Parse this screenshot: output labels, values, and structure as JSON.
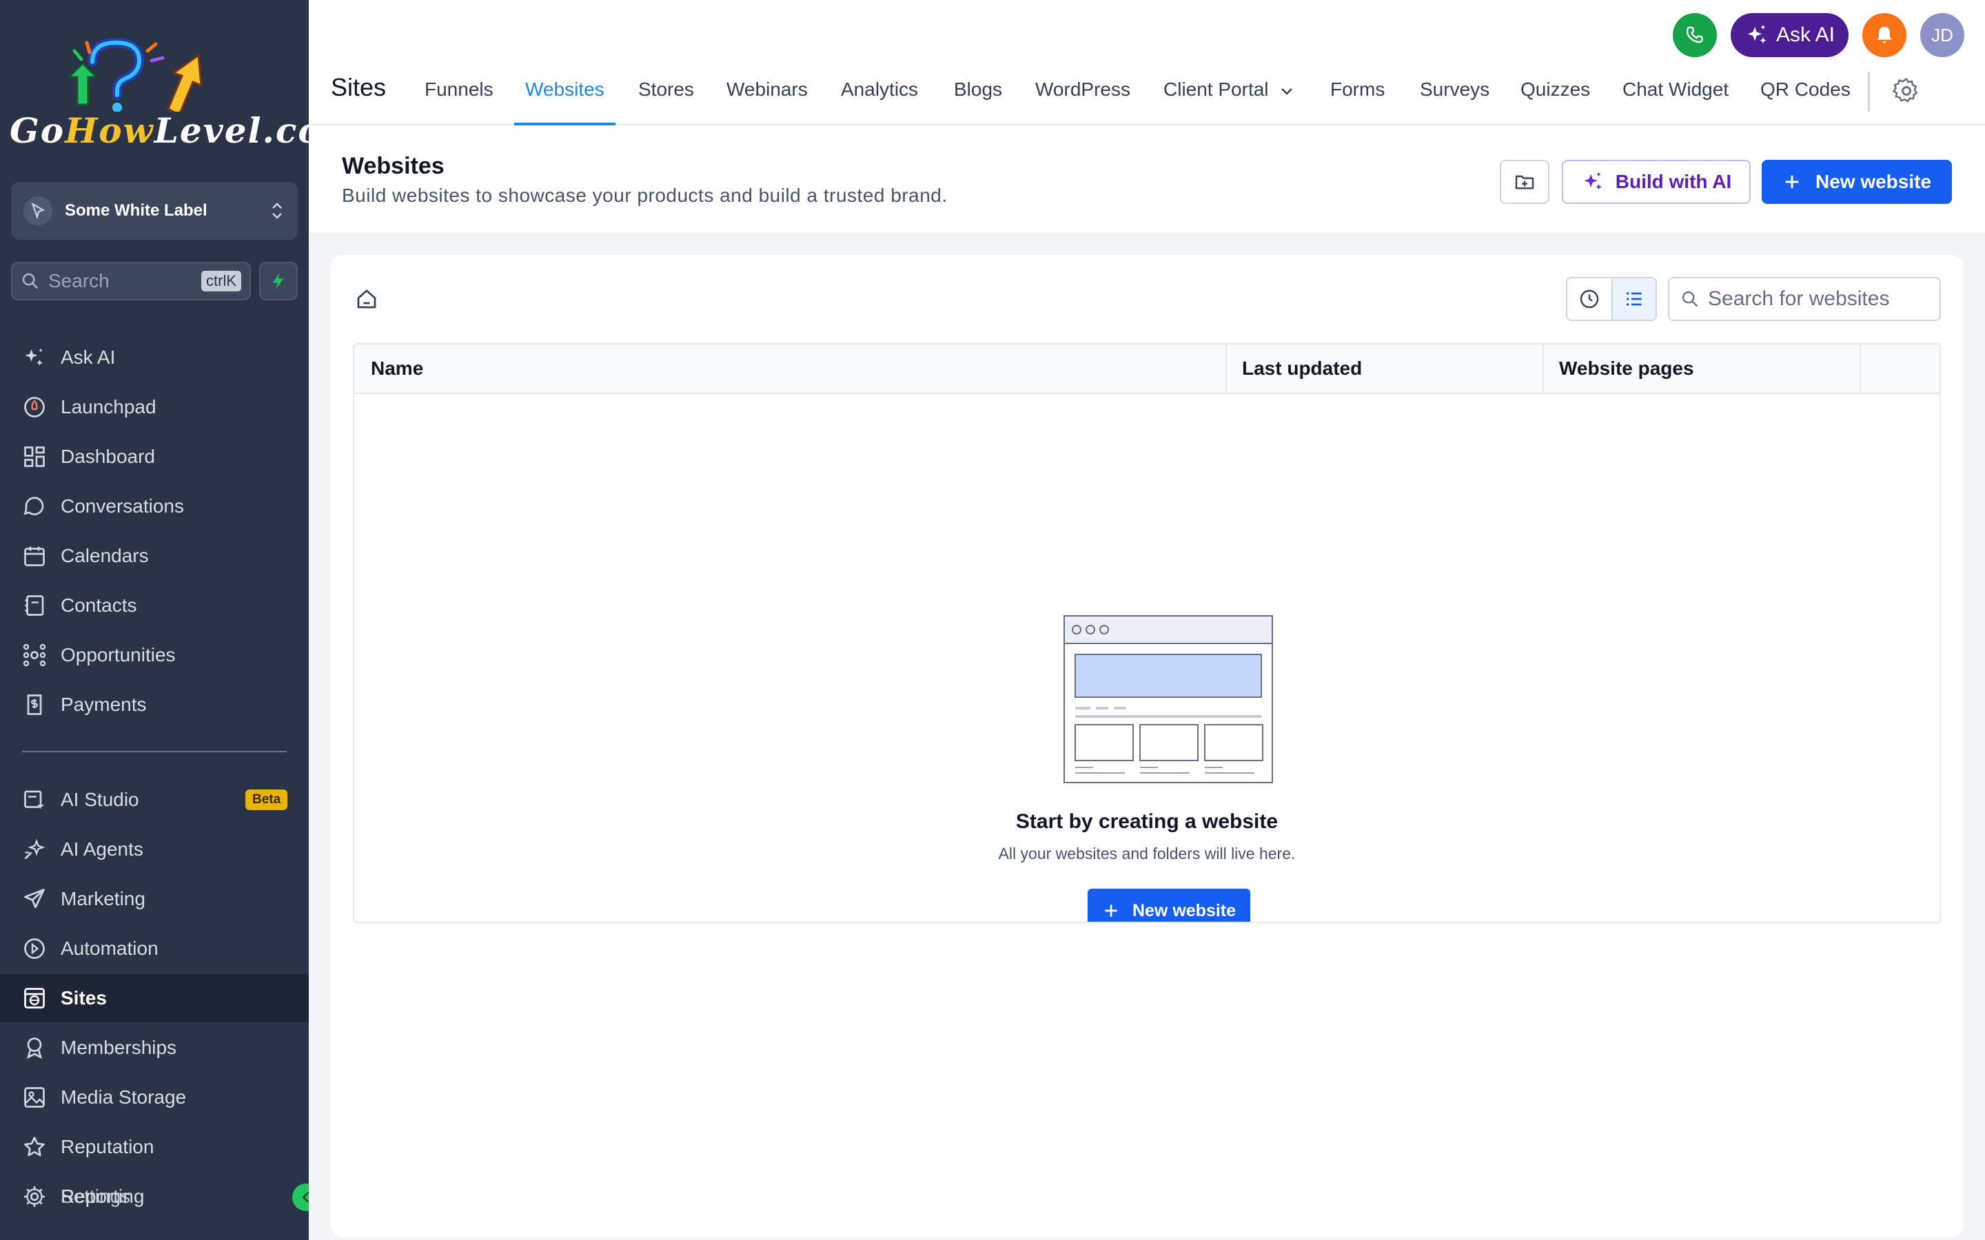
{
  "brand": {
    "logo_text_1": "Go",
    "logo_text_2": "How",
    "logo_text_3": "Level.com"
  },
  "sidebar": {
    "account_name": "Some White Label",
    "search_placeholder": "Search",
    "search_shortcut": "ctrlK",
    "items": [
      {
        "label": "Ask AI",
        "icon": "sparkle-icon"
      },
      {
        "label": "Launchpad",
        "icon": "rocket-icon"
      },
      {
        "label": "Dashboard",
        "icon": "grid-icon"
      },
      {
        "label": "Conversations",
        "icon": "chat-bubble-icon"
      },
      {
        "label": "Calendars",
        "icon": "calendar-icon"
      },
      {
        "label": "Contacts",
        "icon": "contacts-icon"
      },
      {
        "label": "Opportunities",
        "icon": "opportunities-icon"
      },
      {
        "label": "Payments",
        "icon": "payments-icon"
      }
    ],
    "items2": [
      {
        "label": "AI Studio",
        "icon": "ai-studio-icon",
        "badge": "Beta"
      },
      {
        "label": "AI Agents",
        "icon": "ai-agents-icon"
      },
      {
        "label": "Marketing",
        "icon": "send-icon"
      },
      {
        "label": "Automation",
        "icon": "automation-icon"
      },
      {
        "label": "Sites",
        "icon": "globe-window-icon",
        "active": true
      },
      {
        "label": "Memberships",
        "icon": "award-icon"
      },
      {
        "label": "Media Storage",
        "icon": "image-icon"
      },
      {
        "label": "Reputation",
        "icon": "star-icon"
      },
      {
        "label": "Reporting",
        "icon": "reporting-icon"
      },
      {
        "label": "Settings",
        "icon": "gear-icon"
      }
    ]
  },
  "topbar": {
    "page_title": "Sites",
    "tabs": [
      "Funnels",
      "Websites",
      "Stores",
      "Webinars",
      "Analytics",
      "Blogs",
      "WordPress",
      "Client Portal",
      "Forms",
      "Surveys",
      "Quizzes",
      "Chat Widget",
      "QR Codes"
    ],
    "active_tab": "Websites",
    "ask_ai_label": "Ask AI",
    "avatar_initials": "JD",
    "colors": {
      "phone": "#16a34a",
      "ask_ai": "#4c1d95",
      "bell": "#f97316",
      "avatar": "#8b93c9"
    }
  },
  "header": {
    "title": "Websites",
    "subtitle": "Build websites to showcase your products and build a trusted brand.",
    "build_ai_label": "Build with AI",
    "new_website_label": "New website"
  },
  "content": {
    "search_placeholder": "Search for websites",
    "columns": [
      "Name",
      "Last updated",
      "Website pages"
    ],
    "empty_title": "Start by creating a website",
    "empty_subtitle": "All your websites and folders will live here.",
    "empty_button": "New website"
  }
}
